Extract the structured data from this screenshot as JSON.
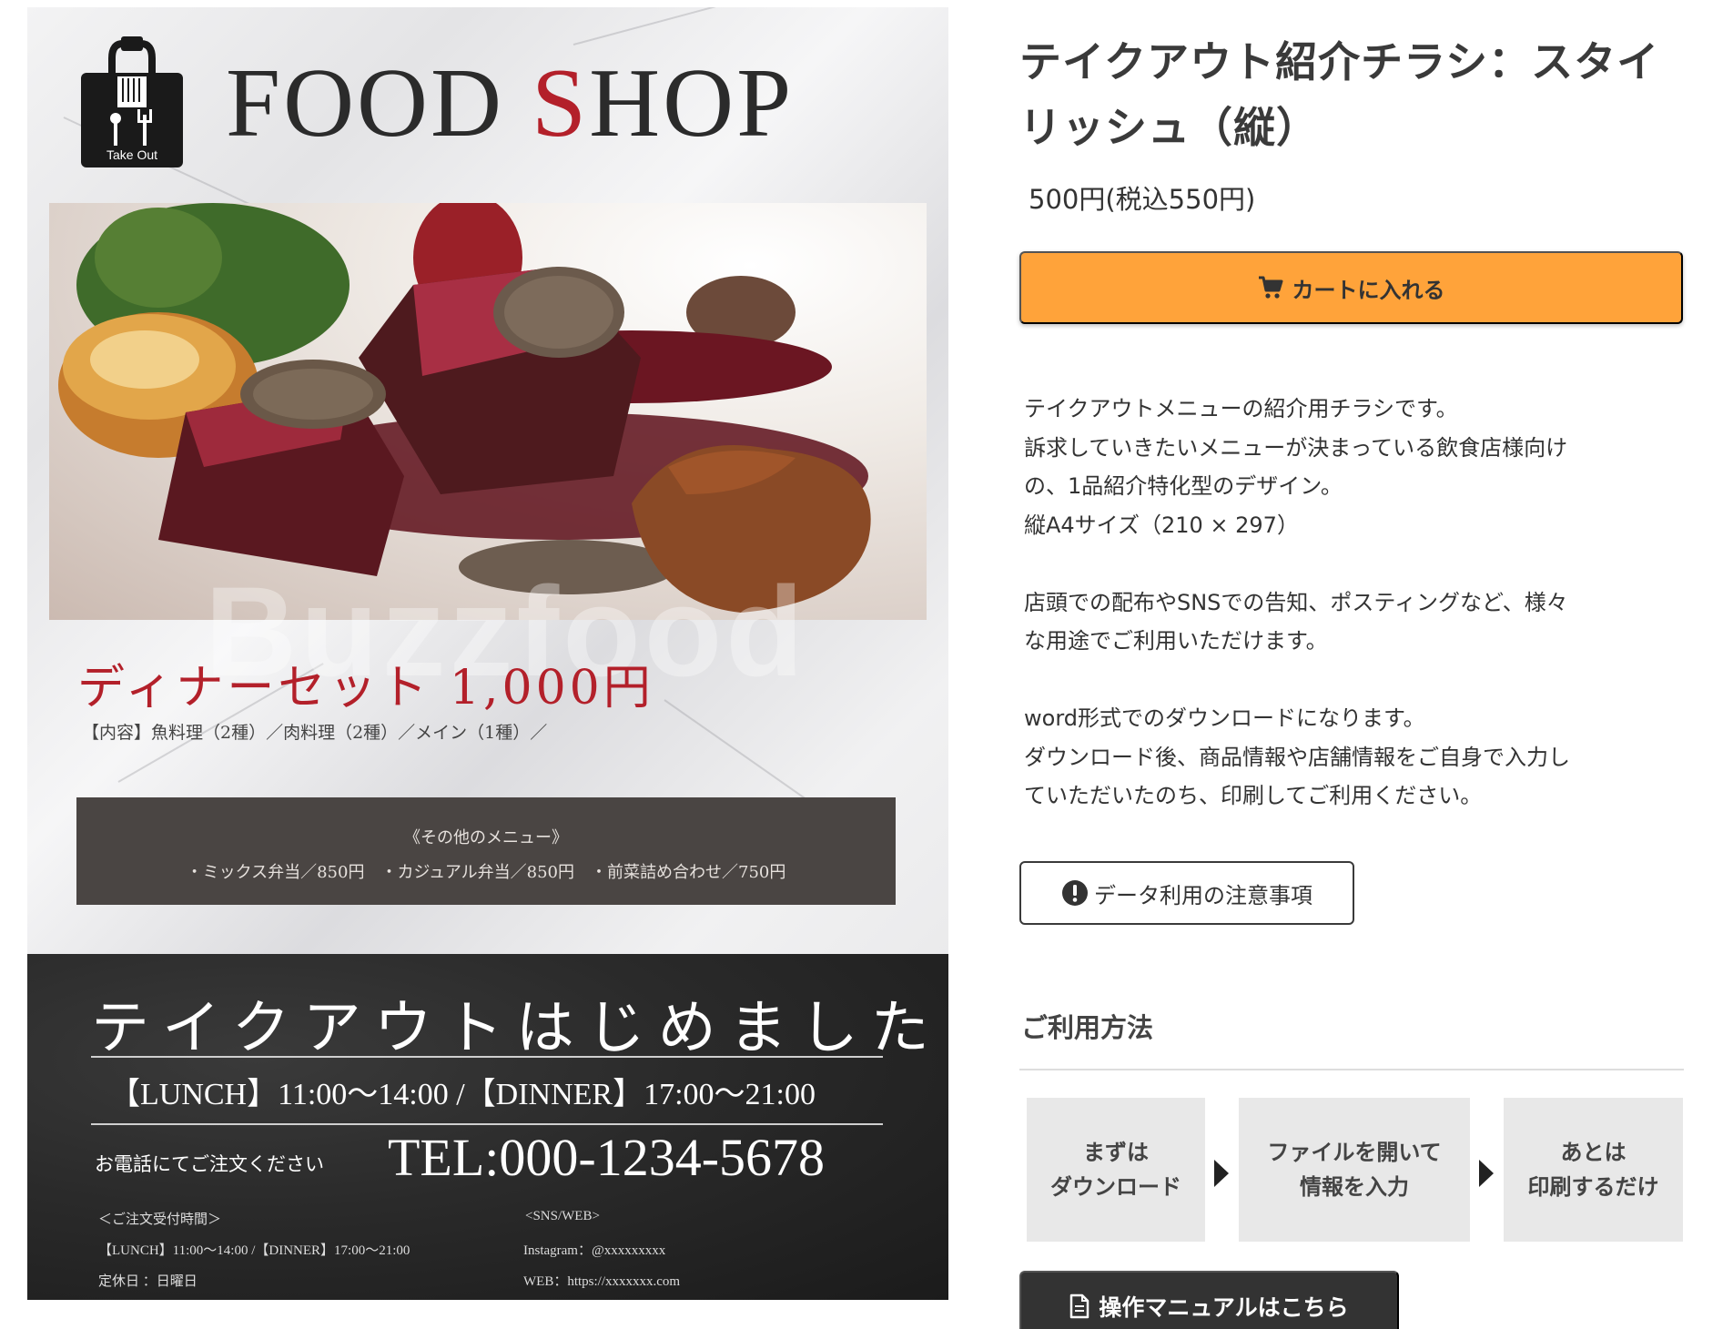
{
  "flyer": {
    "logo_text": "Take Out",
    "brand_prefix": "FOOD ",
    "brand_s": "S",
    "brand_suffix": "HOP",
    "watermark": "Buzzfood",
    "dinner_line": "ディナーセット 1,000円",
    "contents_line": "【内容】魚料理（2種）／肉料理（2種）／メイン（1種）／",
    "other_menu_title": "《その他のメニュー》",
    "other_menu_items": "・ミックス弁当／850円　・カジュアル弁当／850円　・前菜詰め合わせ／750円",
    "takeout_heading": "テイクアウトはじめました",
    "hours": "【LUNCH】11:00〜14:00 /【DINNER】17:00〜21:00",
    "call_label": "お電話にてご注文ください",
    "tel": "TEL:000-1234-5678",
    "order_hours_title": "＜ご注文受付時間＞",
    "order_hours": "【LUNCH】11:00〜14:00 /【DINNER】17:00〜21:00",
    "closed_day": "定休日 ：日曜日",
    "sns_title": "<SNS/WEB>",
    "instagram": "Instagram：@xxxxxxxxx",
    "web": "WEB：https://xxxxxxx.com"
  },
  "product": {
    "title_line1": "テイクアウト紹介チラシ：スタイ",
    "title_line2": "リッシュ（縦）",
    "price": "500円(税込550円)",
    "cart_label": "カートに入れる",
    "description": {
      "p1": [
        "テイクアウトメニューの紹介用チラシです。",
        "訴求していきたいメニューが決まっている飲食店様向け",
        "の、1品紹介特化型のデザイン。",
        "縦A4サイズ（210 × 297）"
      ],
      "p2": [
        "店頭での配布やSNSでの告知、ポスティングなど、様々",
        "な用途でご利用いただけます。"
      ],
      "p3": [
        "word形式でのダウンロードになります。",
        "ダウンロード後、商品情報や店舗情報をご自身で入力し",
        "ていただいたのち、印刷してご利用ください。"
      ]
    },
    "notice_label": "データ利用の注意事項",
    "usage_heading": "ご利用方法",
    "steps": [
      {
        "line1": "まずは",
        "line2": "ダウンロード"
      },
      {
        "line1": "ファイルを開いて",
        "line2": "情報を入力"
      },
      {
        "line1": "あとは",
        "line2": "印刷するだけ"
      }
    ],
    "manual_label": "操作マニュアルはこちら",
    "accent_color": "#ffa33a",
    "brand_red": "#b3202a"
  }
}
